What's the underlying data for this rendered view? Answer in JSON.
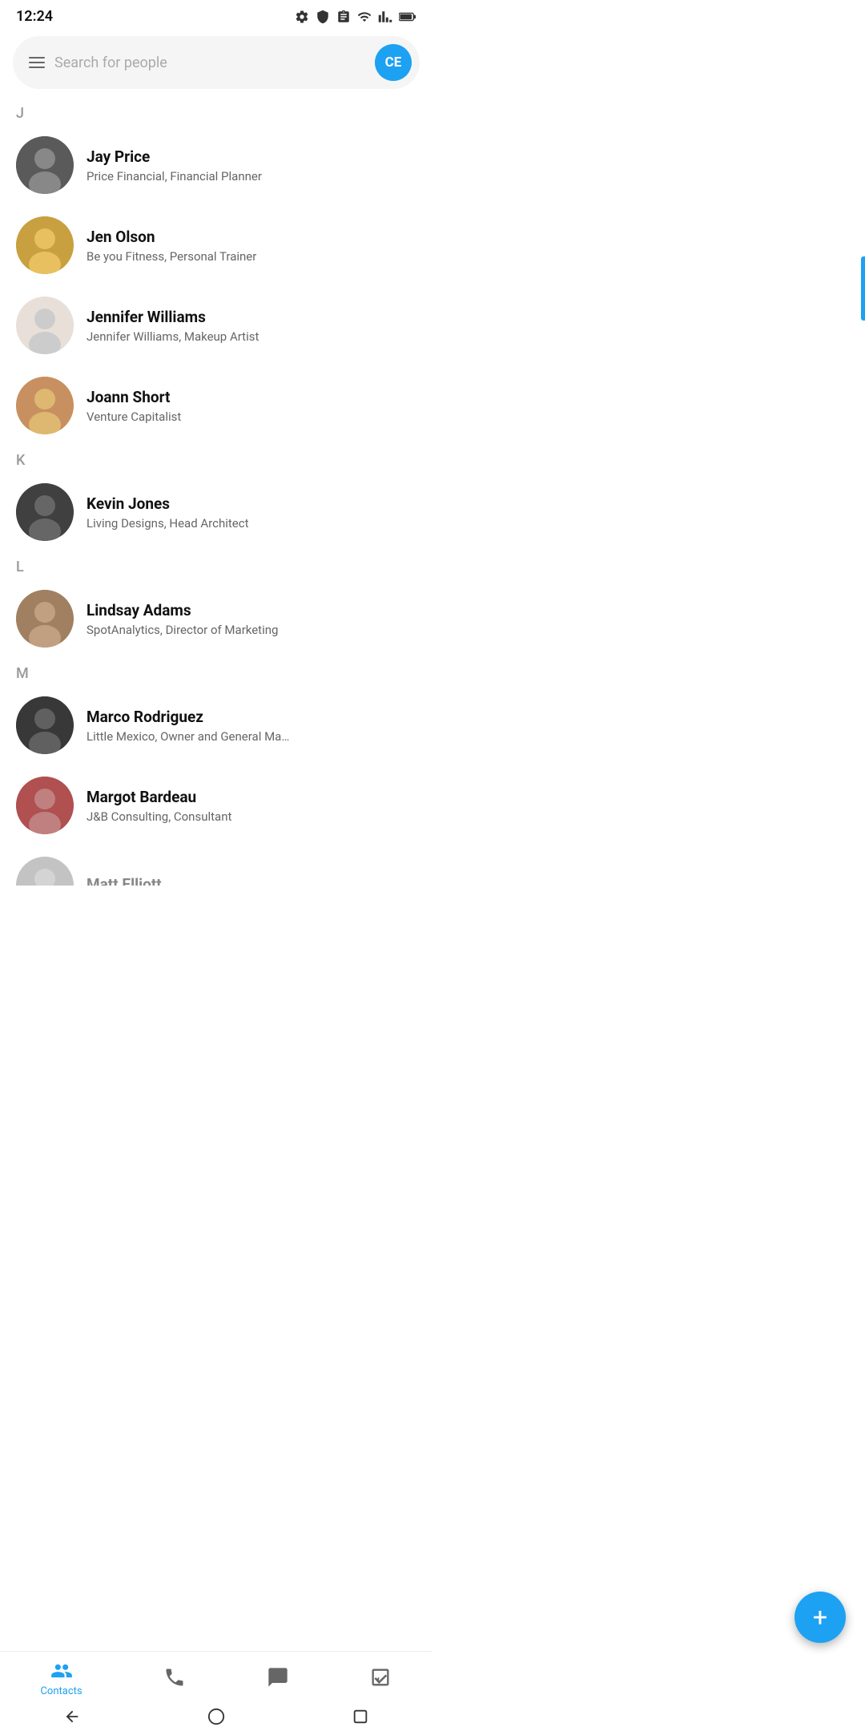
{
  "statusBar": {
    "time": "12:24",
    "icons": [
      "gear",
      "shield",
      "clipboard",
      "wifi",
      "signal",
      "battery"
    ]
  },
  "searchBar": {
    "placeholder": "Search for people",
    "avatarInitials": "CE",
    "avatarColor": "#1DA1F2"
  },
  "sections": [
    {
      "letter": "J",
      "contacts": [
        {
          "id": "jay-price",
          "name": "Jay Price",
          "detail": "Price Financial, Financial Planner",
          "avatarClass": "avatar-jay"
        },
        {
          "id": "jen-olson",
          "name": "Jen Olson",
          "detail": "Be you Fitness, Personal Trainer",
          "avatarClass": "avatar-jen"
        },
        {
          "id": "jennifer-williams",
          "name": "Jennifer Williams",
          "detail": "Jennifer Williams, Makeup Artist",
          "avatarClass": "avatar-jennifer"
        },
        {
          "id": "joann-short",
          "name": "Joann Short",
          "detail": "Venture Capitalist",
          "avatarClass": "avatar-joann"
        }
      ]
    },
    {
      "letter": "K",
      "contacts": [
        {
          "id": "kevin-jones",
          "name": "Kevin Jones",
          "detail": "Living Designs, Head Architect",
          "avatarClass": "avatar-kevin"
        }
      ]
    },
    {
      "letter": "L",
      "contacts": [
        {
          "id": "lindsay-adams",
          "name": "Lindsay Adams",
          "detail": "SpotAnalytics, Director of Marketing",
          "avatarClass": "avatar-lindsay"
        }
      ]
    },
    {
      "letter": "M",
      "contacts": [
        {
          "id": "marco-rodriguez",
          "name": "Marco Rodriguez",
          "detail": "Little Mexico, Owner and General Ma…",
          "avatarClass": "avatar-marco"
        },
        {
          "id": "margot-bardeau",
          "name": "Margot Bardeau",
          "detail": "J&B Consulting, Consultant",
          "avatarClass": "avatar-margot"
        },
        {
          "id": "matt-elliott",
          "name": "Matt Elliott",
          "detail": "",
          "avatarClass": "avatar-matt"
        }
      ]
    }
  ],
  "fab": {
    "label": "+",
    "ariaLabel": "Add new contact"
  },
  "bottomNav": {
    "items": [
      {
        "id": "contacts",
        "label": "Contacts",
        "icon": "contacts",
        "active": true
      },
      {
        "id": "phone",
        "label": "",
        "icon": "phone",
        "active": false
      },
      {
        "id": "messages",
        "label": "",
        "icon": "message",
        "active": false
      },
      {
        "id": "tasks",
        "label": "",
        "icon": "checklist",
        "active": false
      }
    ]
  },
  "androidBar": {
    "buttons": [
      "back",
      "home",
      "recent"
    ]
  }
}
